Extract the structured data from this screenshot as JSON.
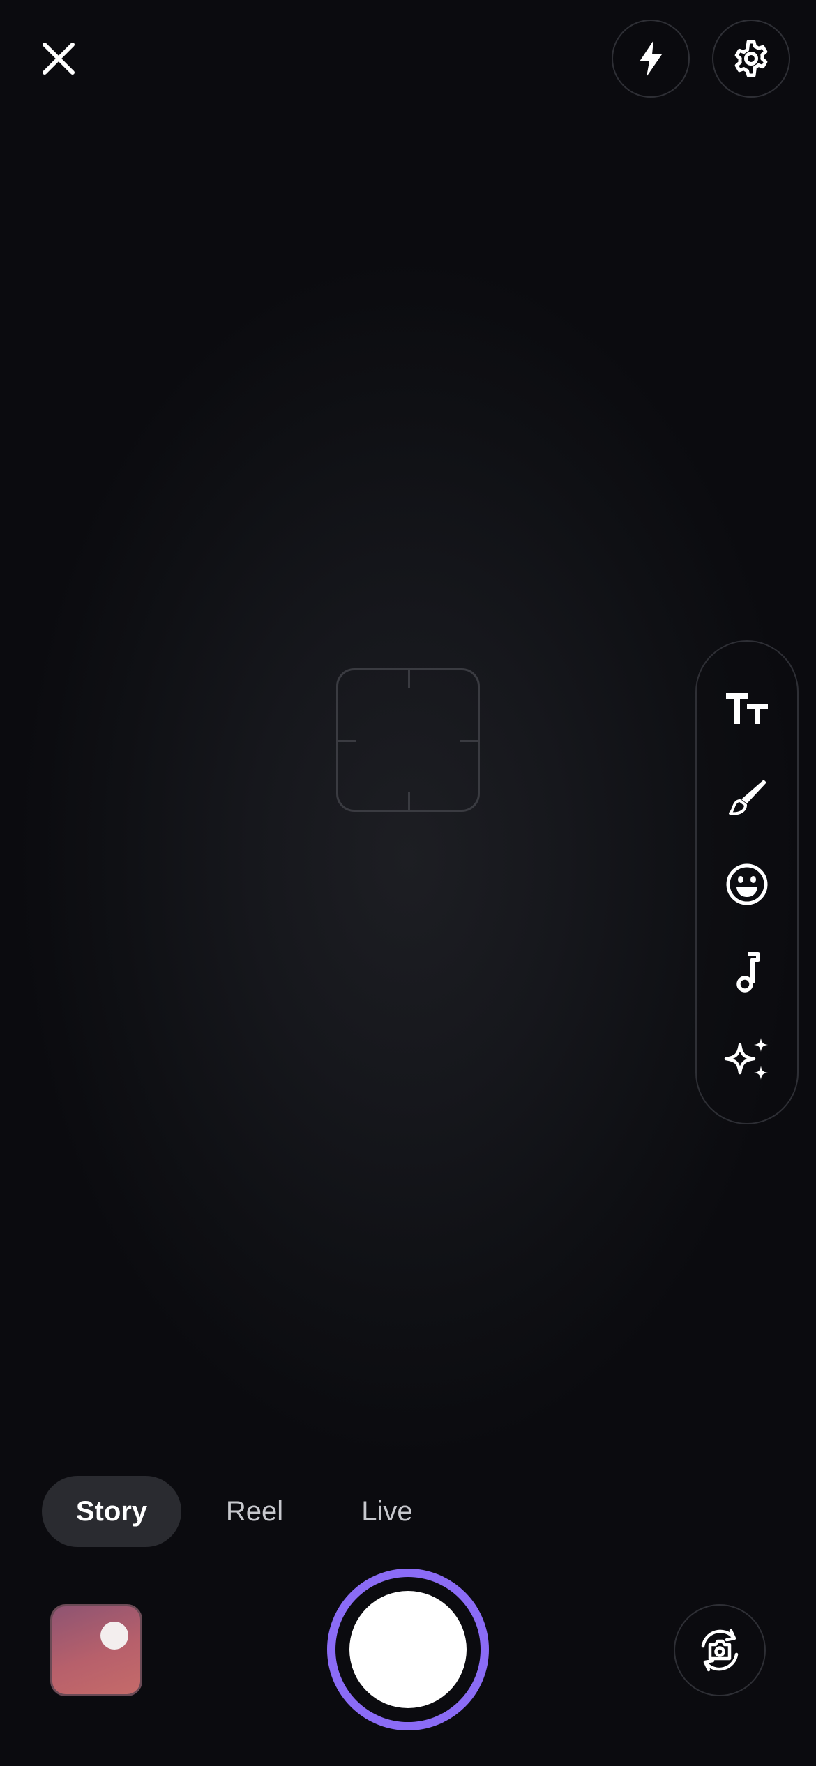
{
  "top_bar": {
    "close_icon": "close-icon",
    "flash_icon": "flash-icon",
    "settings_icon": "gear-icon"
  },
  "viewfinder": {
    "focus_reticle": "focus-reticle"
  },
  "tools": [
    {
      "icon": "text-icon"
    },
    {
      "icon": "brush-icon"
    },
    {
      "icon": "sticker-icon"
    },
    {
      "icon": "music-icon"
    },
    {
      "icon": "effects-sparkle-icon"
    }
  ],
  "modes": {
    "items": [
      {
        "label": "Story",
        "active": true
      },
      {
        "label": "Reel",
        "active": false
      },
      {
        "label": "Live",
        "active": false
      }
    ]
  },
  "bottom_bar": {
    "gallery_icon": "gallery-thumbnail",
    "shutter_icon": "shutter-button",
    "flip_icon": "flip-camera-icon"
  },
  "colors": {
    "background": "#0b0b0f",
    "shutter_ring": "#8b6cf6",
    "active_mode_pill": "#2a2b30",
    "text_primary": "#ffffff",
    "text_secondary": "#c7c8cd"
  }
}
